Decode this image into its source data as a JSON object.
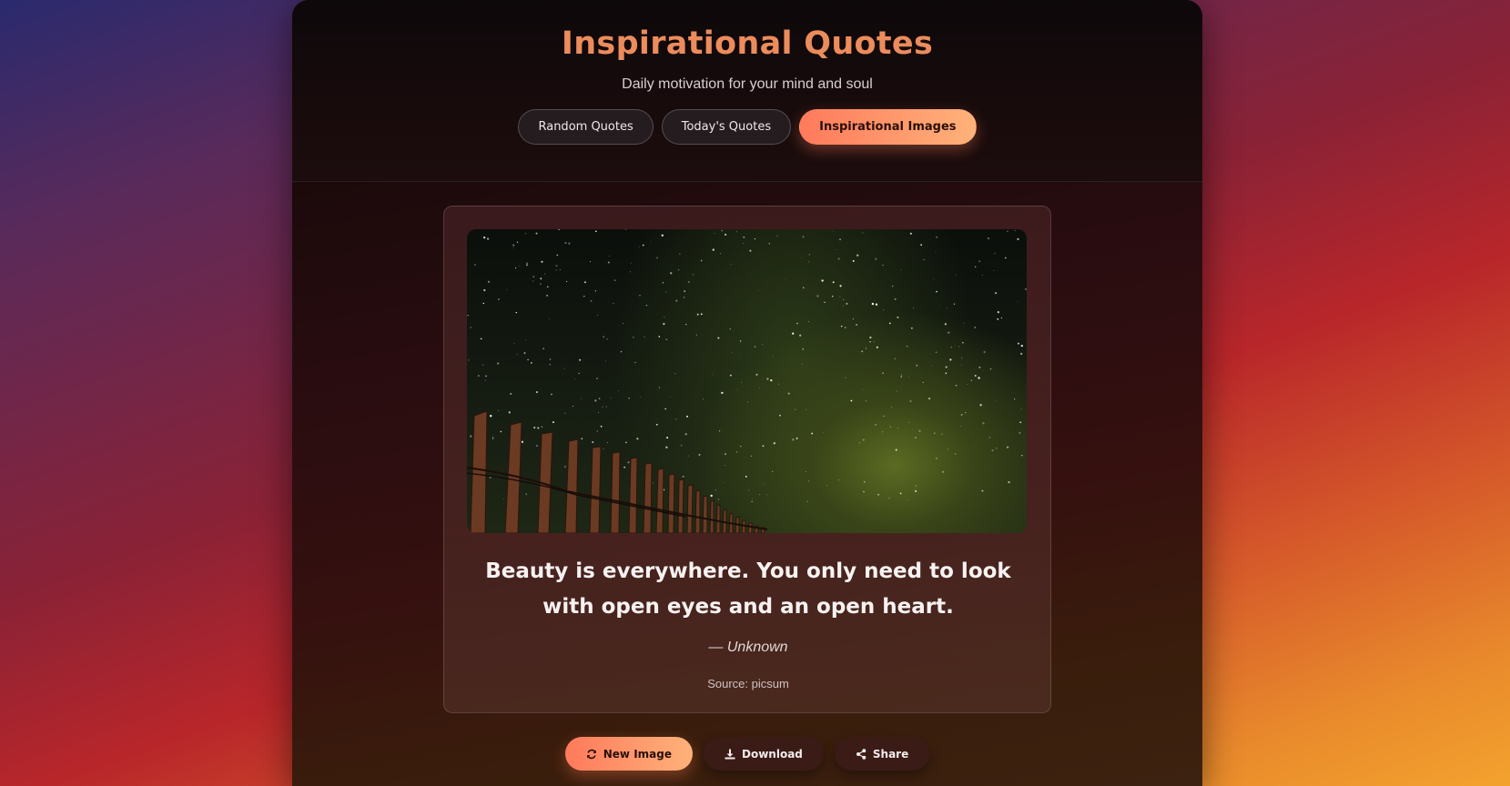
{
  "header": {
    "title": "Inspirational Quotes",
    "subtitle": "Daily motivation for your mind and soul",
    "tabs": [
      {
        "label": "Random Quotes",
        "active": false
      },
      {
        "label": "Today's Quotes",
        "active": false
      },
      {
        "label": "Inspirational Images",
        "active": true
      }
    ]
  },
  "card": {
    "image_icon": "starry-sky-fence-photo",
    "quote": "Beauty is everywhere. You only need to look with open eyes and an open heart.",
    "author": "— Unknown",
    "source": "Source: picsum"
  },
  "actions": {
    "new_image": {
      "label": "New Image",
      "icon": "refresh-icon"
    },
    "download": {
      "label": "Download",
      "icon": "download-icon"
    },
    "share": {
      "label": "Share",
      "icon": "share-icon"
    }
  },
  "colors": {
    "accent_start": "#ff7a5c",
    "accent_end": "#ffb27a",
    "title": "#ec8c5c"
  }
}
